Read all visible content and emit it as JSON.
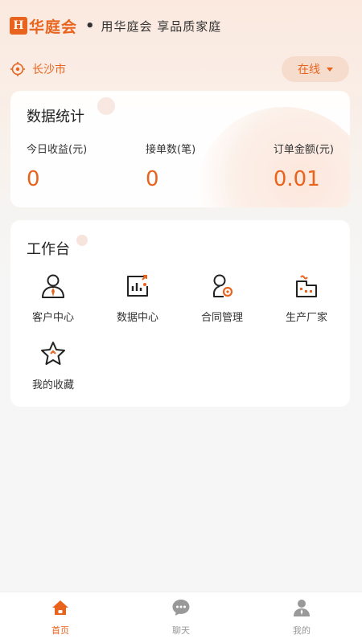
{
  "header": {
    "logo_mark": "H",
    "logo_text": "华庭会",
    "dot": "•",
    "slogan": "用华庭会 享品质家庭"
  },
  "location": {
    "city": "长沙市",
    "status": "在线"
  },
  "stats": {
    "title": "数据统计",
    "items": [
      {
        "label": "今日收益(元)",
        "value": "0"
      },
      {
        "label": "接单数(笔)",
        "value": "0"
      },
      {
        "label": "订单金额(元)",
        "value": "0.01"
      }
    ]
  },
  "workbench": {
    "title": "工作台",
    "tools": [
      {
        "label": "客户中心",
        "icon": "customer-icon"
      },
      {
        "label": "数据中心",
        "icon": "data-icon"
      },
      {
        "label": "合同管理",
        "icon": "contract-icon"
      },
      {
        "label": "生产厂家",
        "icon": "factory-icon"
      },
      {
        "label": "我的收藏",
        "icon": "star-icon"
      }
    ]
  },
  "tabbar": {
    "items": [
      {
        "label": "首页",
        "icon": "home-icon",
        "active": true
      },
      {
        "label": "聊天",
        "icon": "chat-icon",
        "active": false
      },
      {
        "label": "我的",
        "icon": "user-icon",
        "active": false
      }
    ]
  },
  "colors": {
    "accent": "#e8641e",
    "text": "#222222",
    "muted": "#999999"
  }
}
